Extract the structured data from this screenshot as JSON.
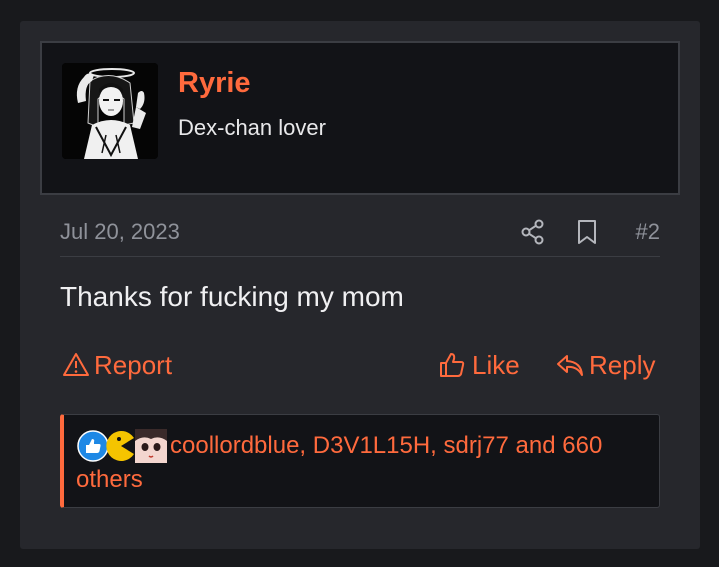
{
  "post": {
    "author": {
      "name": "Ryrie",
      "title": "Dex-chan lover",
      "avatar_icon": "manga-girl-avatar"
    },
    "date": "Jul 20, 2023",
    "share_icon": "share-icon",
    "bookmark_icon": "bookmark-icon",
    "post_number": "#2",
    "message": "Thanks for fucking my mom",
    "actions": {
      "report_label": "Report",
      "like_label": "Like",
      "reply_label": "Reply"
    },
    "reactions": {
      "text": "coollordblue, D3V1L15H, sdrj77 and 660 others",
      "icons": [
        "like-reaction-icon",
        "pacman-reaction-icon",
        "anime-face-reaction-icon"
      ]
    }
  },
  "colors": {
    "accent": "#ff6a3d",
    "background": "#18191c",
    "card": "#26272c",
    "panel": "#121317",
    "muted_text": "#8f929a",
    "like_reaction": "#1e88e5",
    "pacman_reaction": "#f5c400"
  }
}
